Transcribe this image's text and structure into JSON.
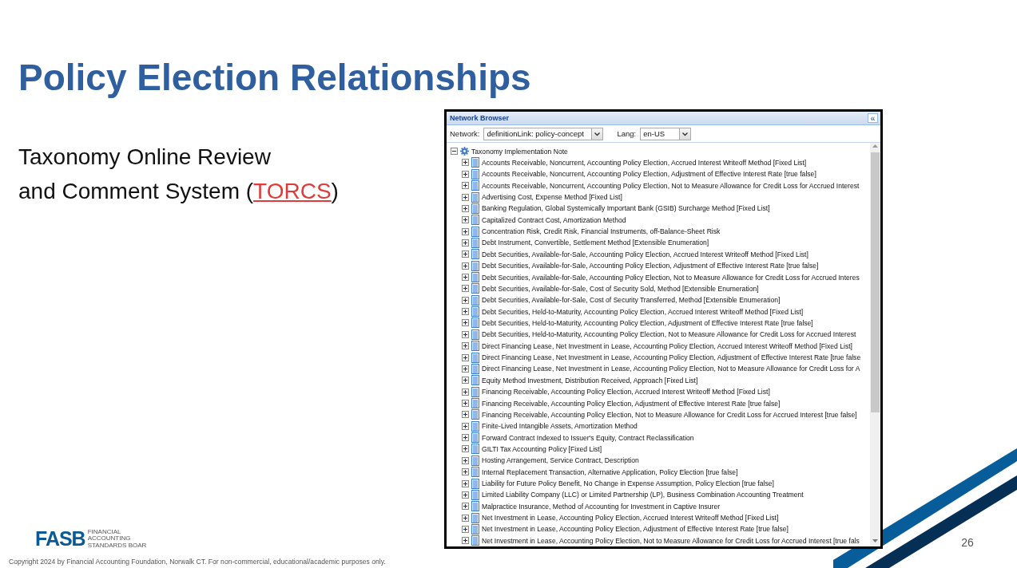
{
  "slide": {
    "title": "Policy Election Relationships",
    "subtitle": {
      "line_1": "Taxonomy Online Review",
      "line_2": "and Comment System (",
      "link": "TORCS",
      "close": ")"
    },
    "logo": {
      "mark": "FASB",
      "lines": [
        "FINANCIAL",
        "ACCOUNTING",
        "STANDARDS BOAR"
      ]
    },
    "page_number": "26",
    "copyright": "Copyright 2024 by Financial Accounting Foundation, Norwalk CT.  For non-commercial, educational/academic purposes only."
  },
  "network_browser": {
    "title": "Network Browser",
    "collapse_button": "«",
    "network": {
      "label": "Network:",
      "value": "definitionLink: policy-concept"
    },
    "lang": {
      "label": "Lang:",
      "value": "en-US"
    },
    "tree": {
      "label": "Taxonomy Implementation Note",
      "expanded": true,
      "children": [
        {
          "label": "Accounts Receivable, Noncurrent, Accounting Policy Election, Accrued Interest Writeoff Method [Fixed List]",
          "expanded": false
        },
        {
          "label": "Accounts Receivable, Noncurrent, Accounting Policy Election, Adjustment of Effective Interest Rate [true false]",
          "expanded": false
        },
        {
          "label": "Accounts Receivable, Noncurrent, Accounting Policy Election, Not to Measure Allowance for Credit Loss for Accrued Interest",
          "expanded": false
        },
        {
          "label": "Advertising Cost, Expense Method [Fixed List]",
          "expanded": false
        },
        {
          "label": "Banking Regulation, Global Systemically Important Bank (GSIB) Surcharge Method [Fixed List]",
          "expanded": false
        },
        {
          "label": "Capitalized Contract Cost, Amortization Method",
          "expanded": false
        },
        {
          "label": "Concentration Risk, Credit Risk, Financial Instruments, off-Balance-Sheet Risk",
          "expanded": false
        },
        {
          "label": "Debt Instrument, Convertible, Settlement Method [Extensible Enumeration]",
          "expanded": false
        },
        {
          "label": "Debt Securities, Available-for-Sale, Accounting Policy Election, Accrued Interest Writeoff Method [Fixed List]",
          "expanded": false
        },
        {
          "label": "Debt Securities, Available-for-Sale, Accounting Policy Election, Adjustment of Effective Interest Rate [true false]",
          "expanded": false
        },
        {
          "label": "Debt Securities, Available-for-Sale, Accounting Policy Election, Not to Measure Allowance for Credit Loss for Accrued Interes",
          "expanded": false
        },
        {
          "label": "Debt Securities, Available-for-Sale, Cost of Security Sold, Method [Extensible Enumeration]",
          "expanded": false
        },
        {
          "label": "Debt Securities, Available-for-Sale, Cost of Security Transferred, Method [Extensible Enumeration]",
          "expanded": false
        },
        {
          "label": "Debt Securities, Held-to-Maturity, Accounting Policy Election, Accrued Interest Writeoff Method [Fixed List]",
          "expanded": false
        },
        {
          "label": "Debt Securities, Held-to-Maturity, Accounting Policy Election, Adjustment of Effective Interest Rate [true false]",
          "expanded": false
        },
        {
          "label": "Debt Securities, Held-to-Maturity, Accounting Policy Election, Not to Measure Allowance for Credit Loss for Accrued Interest",
          "expanded": false
        },
        {
          "label": "Direct Financing Lease, Net Investment in Lease, Accounting Policy Election, Accrued Interest Writeoff Method [Fixed List]",
          "expanded": false
        },
        {
          "label": "Direct Financing Lease, Net Investment in Lease, Accounting Policy Election, Adjustment of Effective Interest Rate [true false",
          "expanded": false
        },
        {
          "label": "Direct Financing Lease, Net Investment in Lease, Accounting Policy Election, Not to Measure Allowance for Credit Loss for A",
          "expanded": false
        },
        {
          "label": "Equity Method Investment, Distribution Received, Approach [Fixed List]",
          "expanded": false
        },
        {
          "label": "Financing Receivable, Accounting Policy Election, Accrued Interest Writeoff Method [Fixed List]",
          "expanded": false
        },
        {
          "label": "Financing Receivable, Accounting Policy Election, Adjustment of Effective Interest Rate [true false]",
          "expanded": false
        },
        {
          "label": "Financing Receivable, Accounting Policy Election, Not to Measure Allowance for Credit Loss for Accrued Interest [true false]",
          "expanded": false
        },
        {
          "label": "Finite-Lived Intangible Assets, Amortization Method",
          "expanded": false
        },
        {
          "label": "Forward Contract Indexed to Issuer's Equity, Contract Reclassification",
          "expanded": false
        },
        {
          "label": "GILTI Tax Accounting Policy [Fixed List]",
          "expanded": false
        },
        {
          "label": "Hosting Arrangement, Service Contract, Description",
          "expanded": false
        },
        {
          "label": "Internal Replacement Transaction, Alternative Application, Policy Election [true false]",
          "expanded": false
        },
        {
          "label": "Liability for Future Policy Benefit, No Change in Expense Assumption, Policy Election [true false]",
          "expanded": false
        },
        {
          "label": "Limited Liability Company (LLC) or Limited Partnership (LP), Business Combination Accounting Treatment",
          "expanded": false
        },
        {
          "label": "Malpractice Insurance, Method of Accounting for Investment in Captive Insurer",
          "expanded": false
        },
        {
          "label": "Net Investment in Lease, Accounting Policy Election, Accrued Interest Writeoff Method [Fixed List]",
          "expanded": false
        },
        {
          "label": "Net Investment in Lease, Accounting Policy Election, Adjustment of Effective Interest Rate [true false]",
          "expanded": false
        },
        {
          "label": "Net Investment in Lease, Accounting Policy Election, Not to Measure Allowance for Credit Loss for Accrued Interest [true fals",
          "expanded": false
        }
      ]
    }
  }
}
